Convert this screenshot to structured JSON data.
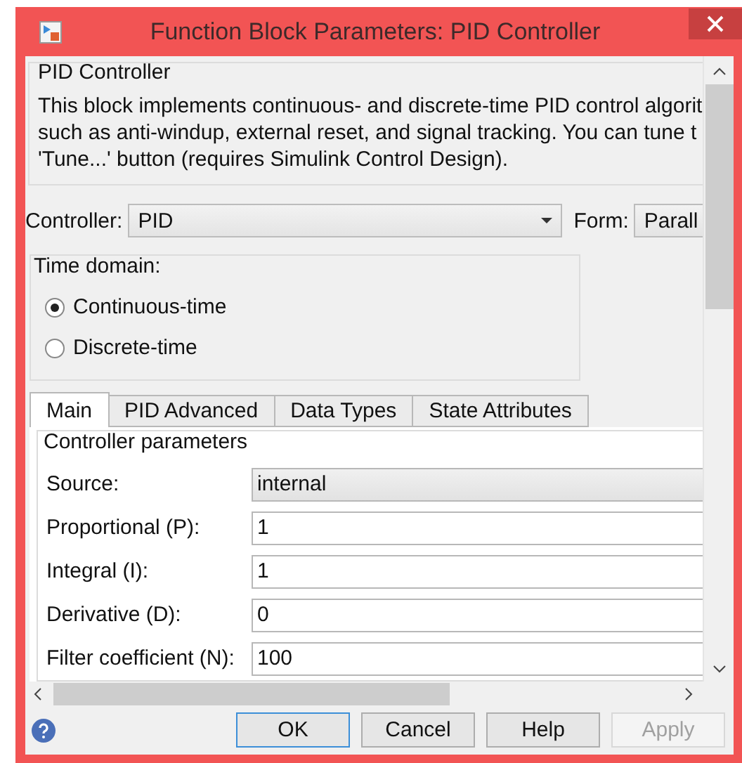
{
  "window": {
    "title": "Function Block Parameters: PID Controller"
  },
  "group": {
    "title": "PID Controller",
    "description": [
      "This block implements continuous- and discrete-time PID control algorit",
      "such as anti-windup, external reset, and signal tracking. You can tune t",
      "'Tune...' button (requires Simulink Control Design)."
    ]
  },
  "controller": {
    "label": "Controller:",
    "value": "PID"
  },
  "form": {
    "label": "Form:",
    "value": "Parall"
  },
  "time_domain": {
    "title": "Time domain:",
    "options": [
      {
        "label": "Continuous-time",
        "selected": true
      },
      {
        "label": "Discrete-time",
        "selected": false
      }
    ]
  },
  "tabs": [
    {
      "label": "Main",
      "selected": true
    },
    {
      "label": "PID Advanced",
      "selected": false
    },
    {
      "label": "Data Types",
      "selected": false
    },
    {
      "label": "State Attributes",
      "selected": false
    }
  ],
  "parameters": {
    "title": "Controller parameters",
    "rows": [
      {
        "kind": "dropdown",
        "label": "Source:",
        "value": "internal"
      },
      {
        "kind": "text",
        "label": "Proportional (P):",
        "value": "1"
      },
      {
        "kind": "text",
        "label": "Integral (I):",
        "value": "1"
      },
      {
        "kind": "text",
        "label": "Derivative (D):",
        "value": "0"
      },
      {
        "kind": "text",
        "label": "Filter coefficient (N):",
        "value": "100"
      }
    ]
  },
  "buttons": [
    {
      "label": "OK",
      "default": true,
      "disabled": false
    },
    {
      "label": "Cancel",
      "default": false,
      "disabled": false
    },
    {
      "label": "Help",
      "default": false,
      "disabled": false
    },
    {
      "label": "Apply",
      "default": false,
      "disabled": true
    }
  ]
}
